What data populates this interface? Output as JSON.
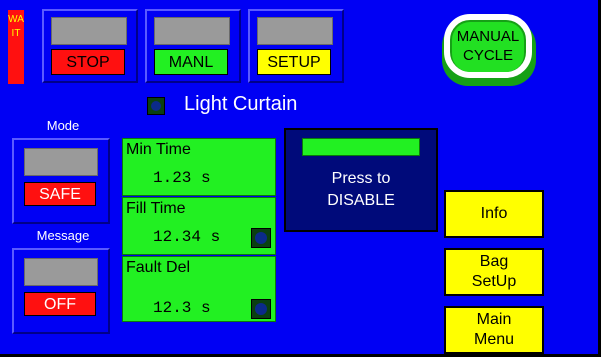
{
  "wait_indicator": "WAIT",
  "top_buttons": [
    {
      "label": "STOP",
      "color": "#ff1010",
      "text_color": "#000000"
    },
    {
      "label": "MANL",
      "color": "#22f022",
      "text_color": "#000000"
    },
    {
      "label": "SETUP",
      "color": "#ffff00",
      "text_color": "#000000"
    }
  ],
  "manual_cycle": {
    "line1": "MANUAL",
    "line2": "CYCLE"
  },
  "light_curtain": {
    "label": "Light Curtain"
  },
  "mode": {
    "heading": "Mode",
    "value": "SAFE"
  },
  "message": {
    "heading": "Message",
    "value": "OFF"
  },
  "timers": [
    {
      "title": "Min Time",
      "value": "1.23 s",
      "has_led": false
    },
    {
      "title": "Fill Time",
      "value": "12.34 s",
      "has_led": true
    },
    {
      "title": "Fault Del",
      "value": "12.3 s",
      "has_led": true
    }
  ],
  "disable_button": {
    "line1": "Press to",
    "line2": "DISABLE"
  },
  "side_buttons": [
    {
      "line1": "Info",
      "line2": ""
    },
    {
      "line1": "Bag",
      "line2": "SetUp"
    },
    {
      "line1": "Main",
      "line2": "Menu"
    }
  ],
  "colors": {
    "background": "#0000f4",
    "accent_green": "#22f022",
    "alarm_red": "#ff1010",
    "warning_yellow": "#ffff00"
  }
}
